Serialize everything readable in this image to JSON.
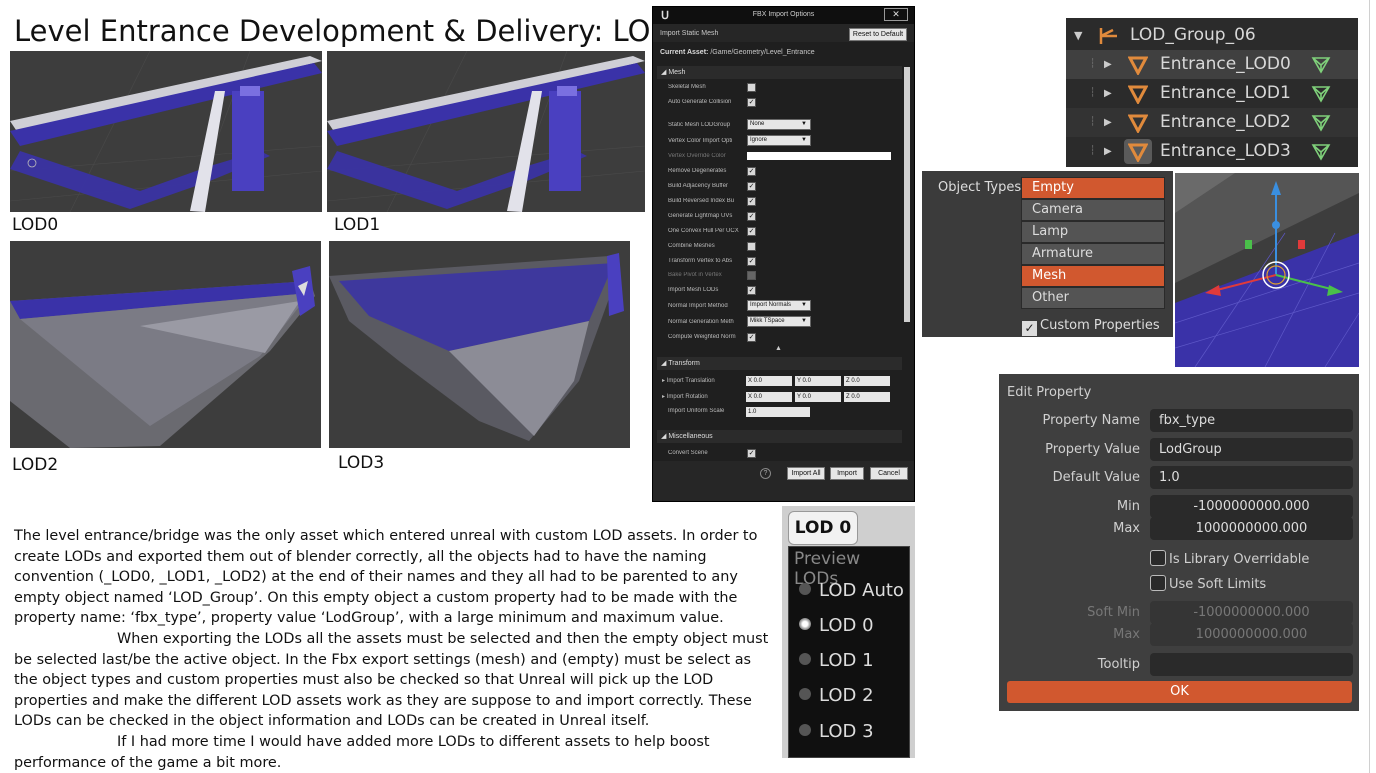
{
  "title": "Level Entrance Development & Delivery: LODs",
  "lod_captions": [
    "LOD0",
    "LOD1",
    "LOD2",
    "LOD3"
  ],
  "fbx_dialog": {
    "window_title": "FBX Import Options",
    "subtitle": "Import Static Mesh",
    "reset_label": "Reset to Default",
    "current_asset_label": "Current Asset:",
    "current_asset_value": "/Game/Geometry/Level_Entrance",
    "sections": {
      "mesh": "Mesh",
      "transform": "Transform",
      "misc": "Miscellaneous"
    },
    "mesh_rows": [
      "Skeletal Mesh",
      "Auto Generate Collision",
      "Static Mesh LODGroup",
      "Vertex Color Import Opti",
      "Vertex Override Color",
      "Remove Degenerates",
      "Build Adjacency Buffer",
      "Build Reversed Index Bu",
      "Generate Lightmap UVs",
      "One Convex Hull Per UCX",
      "Combine Meshes",
      "Transform Vertex to Abs",
      "Bake Pivot in Vertex",
      "Import Mesh LODs",
      "Normal Import Method",
      "Normal Generation Meth",
      "Compute Weighted Norm"
    ],
    "dropdowns": {
      "lod_group": "None",
      "vertex_color": "Ignore",
      "normal_import": "Import Normals",
      "normal_generation": "Mikk TSpace"
    },
    "transform_rows": [
      "Import Translation",
      "Import Rotation",
      "Import Uniform Scale"
    ],
    "vector_values": {
      "translation": [
        "X 0.0",
        "Y 0.0",
        "Z 0.0"
      ],
      "rotation": [
        "X 0.0",
        "Y 0.0",
        "Z 0.0"
      ],
      "scale": "1.0"
    },
    "misc_rows": [
      "Convert Scene"
    ],
    "help_icon": "?",
    "buttons": {
      "import_all": "Import All",
      "import": "Import",
      "cancel": "Cancel"
    }
  },
  "outliner": {
    "group": "LOD_Group_06",
    "items": [
      "Entrance_LOD0",
      "Entrance_LOD1",
      "Entrance_LOD2",
      "Entrance_LOD3"
    ]
  },
  "object_types": {
    "label": "Object Types",
    "options": [
      "Empty",
      "Camera",
      "Lamp",
      "Armature",
      "Mesh",
      "Other"
    ],
    "selected": [
      "Empty",
      "Mesh"
    ],
    "custom_properties": "Custom Properties"
  },
  "edit_property": {
    "title": "Edit Property",
    "property_name_label": "Property Name",
    "property_name": "fbx_type",
    "property_value_label": "Property Value",
    "property_value": "LodGroup",
    "default_value_label": "Default Value",
    "default_value": "1.0",
    "min_label": "Min",
    "min": "-1000000000.000",
    "max_label": "Max",
    "max": "1000000000.000",
    "library_overridable": "Is Library Overridable",
    "soft_limits": "Use Soft Limits",
    "soft_min_label": "Soft Min",
    "soft_min": "-1000000000.000",
    "soft_max_label": "Max",
    "soft_max": "1000000000.000",
    "tooltip_label": "Tooltip",
    "ok": "OK"
  },
  "lod_preview": {
    "current": "LOD 0",
    "header": "Preview LODs",
    "items": [
      "LOD Auto",
      "LOD 0",
      "LOD 1",
      "LOD 2",
      "LOD 3"
    ],
    "selected": "LOD 0"
  },
  "body": {
    "p1": "The level entrance/bridge was the only asset which entered unreal with custom LOD assets. In order to create LODs and exported them out of blender correctly, all the objects had to have the naming convention (_LOD0, _LOD1, _LOD2) at the end of their names and they all had to be parented to any empty object named ‘LOD_Group’. On this empty object a custom property had to be made with the property name: ‘fbx_type’, property value ‘LodGroup’, with a large minimum and maximum value.",
    "p2": "When exporting the LODs all the assets must be selected and then the empty object must be selected last/be the active object. In the Fbx export settings (mesh) and (empty) must be select as the object types and custom properties must also be checked so that Unreal will pick up the LOD properties and make the different LOD assets work as they are suppose to and import correctly. These LODs can be checked in the object information and LODs can be created in Unreal itself.",
    "p3": "If I had more time I would have added more LODs to different assets to help boost performance of the game a bit more."
  },
  "colors": {
    "blender_orange": "#d1582f",
    "mesh_blue": "#3a32a8",
    "viewport_bg": "#3d3d3d"
  }
}
